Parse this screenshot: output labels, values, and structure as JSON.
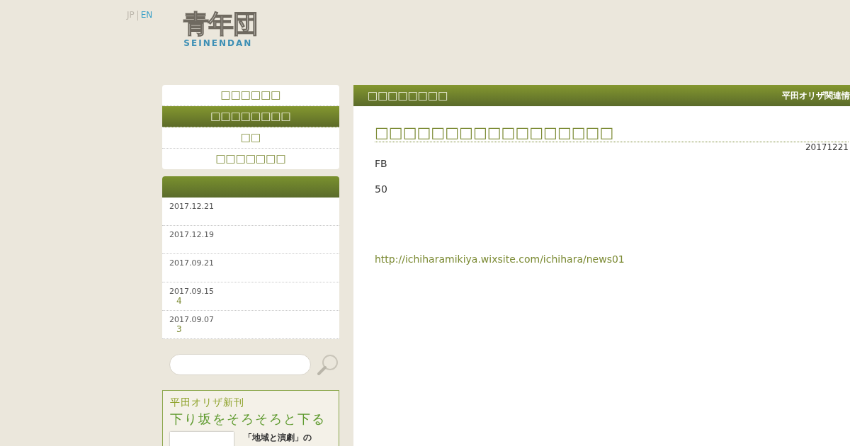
{
  "languages": [
    {
      "label": "JP",
      "selected": false
    },
    {
      "label": "EN",
      "selected": true
    }
  ],
  "logo": {
    "title": "青年団",
    "subtitle": "SEINENDAN"
  },
  "nav": [
    {
      "label": "□□□□□□",
      "selected": false
    },
    {
      "label": "□□□□□□□□",
      "selected": true
    },
    {
      "label": "□□",
      "selected": false
    },
    {
      "label": "□□□□□□□",
      "selected": false
    }
  ],
  "recent": [
    {
      "date": "2017.12.21"
    },
    {
      "date": "2017.12.19"
    },
    {
      "date": "2017.09.21"
    },
    {
      "date": "2017.09.15",
      "link": "4"
    },
    {
      "date": "2017.09.07",
      "link": "3"
    }
  ],
  "banner": {
    "kicker": "平田オリザ新刊",
    "title": "下り坂をそろそろと下る",
    "caption": "「地域と演劇」の"
  },
  "panel": {
    "heading": "□□□□□□□□",
    "category": "平田オリザ関連情"
  },
  "article": {
    "title": "□□□□□□□□□□□□□□□□□",
    "date": "20171221",
    "paragraphs": [
      {
        "kind": "text",
        "text": "FB"
      },
      {
        "kind": "text",
        "text": "50"
      },
      {
        "kind": "gap"
      },
      {
        "kind": "link",
        "text": "http://ichiharamikiya.wixsite.com/ichihara/news01"
      }
    ]
  }
}
